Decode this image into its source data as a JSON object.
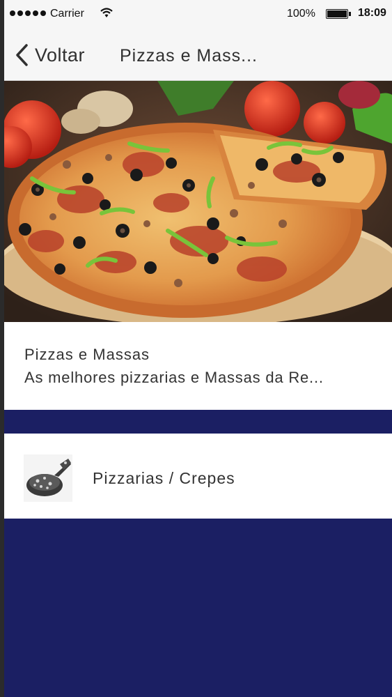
{
  "status_bar": {
    "carrier": "Carrier",
    "battery_percent": "100%",
    "time": "18:09"
  },
  "nav": {
    "back_label": "Voltar",
    "title": "Pizzas e Mass..."
  },
  "hero": {
    "image": "pizza-photo"
  },
  "info": {
    "title": "Pizzas e Massas",
    "subtitle": "As melhores pizzarias e Massas da Re..."
  },
  "list": {
    "items": [
      {
        "label": "Pizzarias / Crepes",
        "icon": "pizza-icon"
      }
    ]
  },
  "colors": {
    "accent": "#1b1f63",
    "bar_background": "#f6f6f6",
    "card_background": "#ffffff",
    "text": "#333333"
  }
}
